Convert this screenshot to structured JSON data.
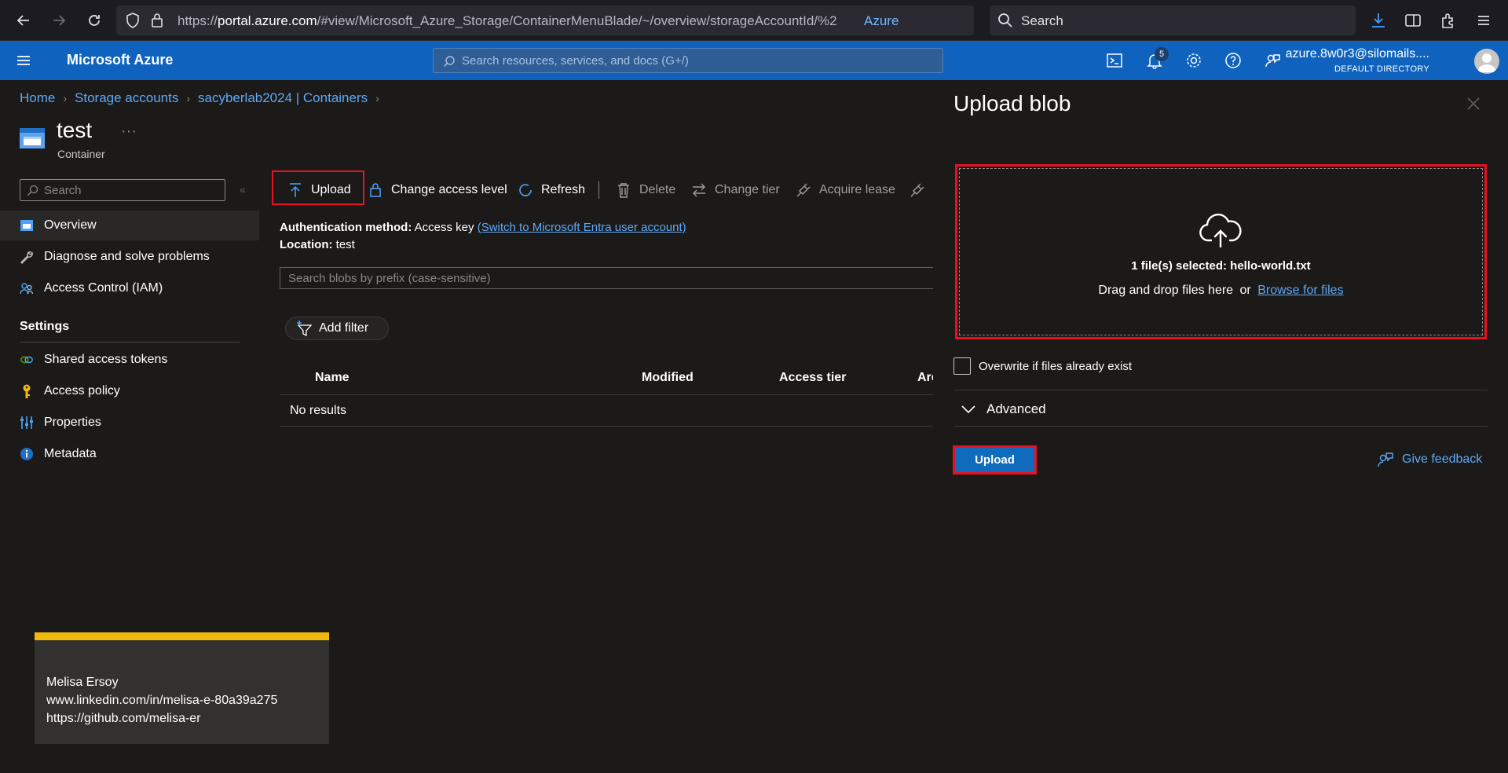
{
  "browser": {
    "url_host": "portal.azure.com",
    "url_prefix": "https://",
    "url_path": "/#view/Microsoft_Azure_Storage/ContainerMenuBlade/~/overview/storageAccountId/%2",
    "container_label": "Azure",
    "search_placeholder": "Search"
  },
  "header": {
    "brand": "Microsoft Azure",
    "search_placeholder": "Search resources, services, and docs (G+/)",
    "notification_count": "5",
    "account_name": "azure.8w0r3@silomails....",
    "account_directory": "DEFAULT DIRECTORY",
    "accent_color": "#0f63bf"
  },
  "breadcrumb": {
    "items": [
      "Home",
      "Storage accounts",
      "sacyberlab2024 | Containers"
    ]
  },
  "page": {
    "title": "test",
    "more": "···",
    "subtitle": "Container"
  },
  "sidebar": {
    "search_placeholder": "Search",
    "collapse_glyph": "«",
    "items": [
      {
        "label": "Overview",
        "icon": "overview-icon"
      },
      {
        "label": "Diagnose and solve problems",
        "icon": "wrench-icon"
      },
      {
        "label": "Access Control (IAM)",
        "icon": "people-icon"
      }
    ],
    "section_label": "Settings",
    "settings_items": [
      {
        "label": "Shared access tokens",
        "icon": "link-icon"
      },
      {
        "label": "Access policy",
        "icon": "key-icon"
      },
      {
        "label": "Properties",
        "icon": "properties-icon"
      },
      {
        "label": "Metadata",
        "icon": "info-icon"
      }
    ]
  },
  "toolbar": {
    "upload": "Upload",
    "change_access_level": "Change access level",
    "refresh": "Refresh",
    "delete": "Delete",
    "change_tier": "Change tier",
    "acquire_lease": "Acquire lease"
  },
  "main": {
    "auth_label": "Authentication method:",
    "auth_value": "Access key",
    "auth_link": "(Switch to Microsoft Entra user account)",
    "location_label": "Location:",
    "location_value": "test",
    "blob_search_placeholder": "Search blobs by prefix (case-sensitive)",
    "add_filter": "Add filter",
    "columns": [
      "Name",
      "Modified",
      "Access tier",
      "Arc"
    ],
    "empty_text": "No results"
  },
  "upload_panel": {
    "title": "Upload blob",
    "files_selected": "1 file(s) selected: hello-world.txt",
    "drag_text": "Drag and drop files here",
    "or_text": "or",
    "browse_link": "Browse for files",
    "overwrite_label": "Overwrite if files already exist",
    "overwrite_checked": false,
    "advanced_label": "Advanced",
    "upload_button": "Upload",
    "feedback_link": "Give feedback"
  },
  "credit": {
    "name": "Melisa Ersoy",
    "linkedin": "www.linkedin.com/in/melisa-e-80a39a275",
    "github": "https://github.com/melisa-er"
  }
}
